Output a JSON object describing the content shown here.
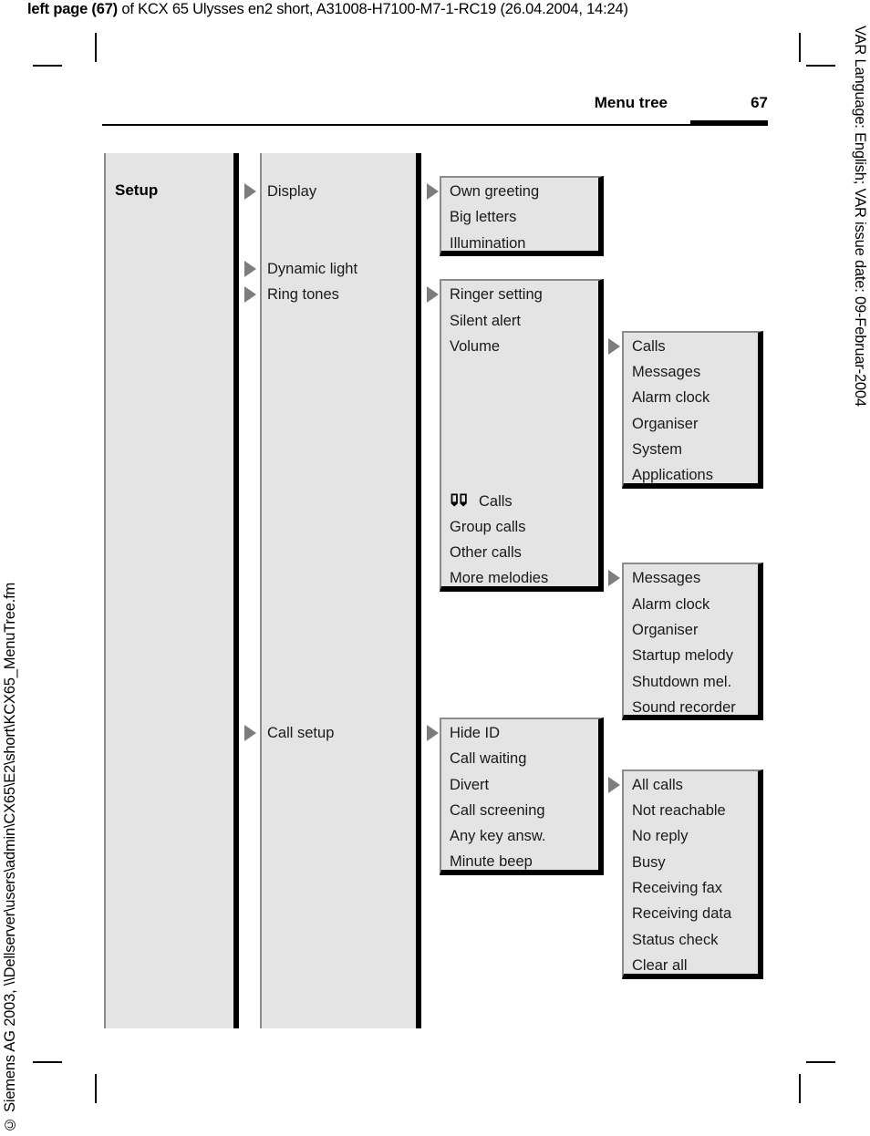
{
  "print_header": {
    "bold_prefix": "left page (67)",
    "rest": " of KCX 65 Ulysses en2 short, A31008-H7100-M7-1-RC19 (26.04.2004, 14:24)"
  },
  "page_header": {
    "title": "Menu tree",
    "page_number": "67"
  },
  "side_texts": {
    "right": "VAR Language: English; VAR issue date: 09-Februar-2004",
    "left": "© Siemens AG 2003, \\\\Dellserver\\users\\admin\\CX65\\E2\\short\\KCX65_MenuTree.fm"
  },
  "colors": {
    "panel_fill": "#e4e4e4",
    "shadow": "#000000",
    "hairline": "#8c8c8c",
    "arrow": "#7d7d7d"
  },
  "menu_tree": {
    "root": "Setup",
    "level1": [
      "Display",
      "Dynamic light",
      "Ring tones",
      "Call setup"
    ],
    "display_group": [
      "Own greeting",
      "Big letters",
      "Illumination"
    ],
    "ring_tones_group_top": [
      "Ringer setting",
      "Silent alert",
      "Volume"
    ],
    "ring_tones_group_bottom": [
      "Calls",
      "Group calls",
      "Other calls",
      "More melodies"
    ],
    "volume_group": [
      "Calls",
      "Messages",
      "Alarm clock",
      "Organiser",
      "System",
      "Applications"
    ],
    "more_melodies_group": [
      "Messages",
      "Alarm clock",
      "Organiser",
      "Startup melody",
      "Shutdown mel.",
      "Sound recorder"
    ],
    "call_setup_group": [
      "Hide ID",
      "Call waiting",
      "Divert",
      "Call screening",
      "Any key answ.",
      "Minute beep"
    ],
    "divert_group": [
      "All calls",
      "Not reachable",
      "No reply",
      "Busy",
      "Receiving fax",
      "Receiving data",
      "Status check",
      "Clear all"
    ],
    "icons": {
      "calls_book": "book-icon"
    }
  }
}
